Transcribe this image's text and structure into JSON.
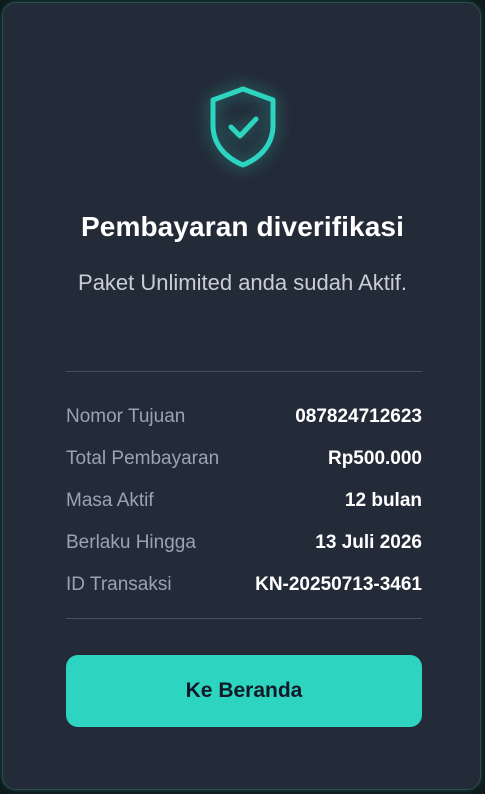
{
  "status": {
    "icon": "shield-check-icon",
    "title": "Pembayaran diverifikasi",
    "message": "Paket Unlimited anda sudah Aktif."
  },
  "details": [
    {
      "label": "Nomor Tujuan",
      "value": "087824712623"
    },
    {
      "label": "Total Pembayaran",
      "value": "Rp500.000"
    },
    {
      "label": "Masa Aktif",
      "value": "12 bulan"
    },
    {
      "label": "Berlaku Hingga",
      "value": "13 Juli 2026"
    },
    {
      "label": "ID Transaksi",
      "value": "KN-20250713-3461"
    }
  ],
  "actions": {
    "home_label": "Ke Beranda"
  },
  "colors": {
    "accent": "#2dd4bf",
    "card_bg": "#232b38",
    "text_primary": "#ffffff",
    "text_muted": "#9aa3b0"
  }
}
